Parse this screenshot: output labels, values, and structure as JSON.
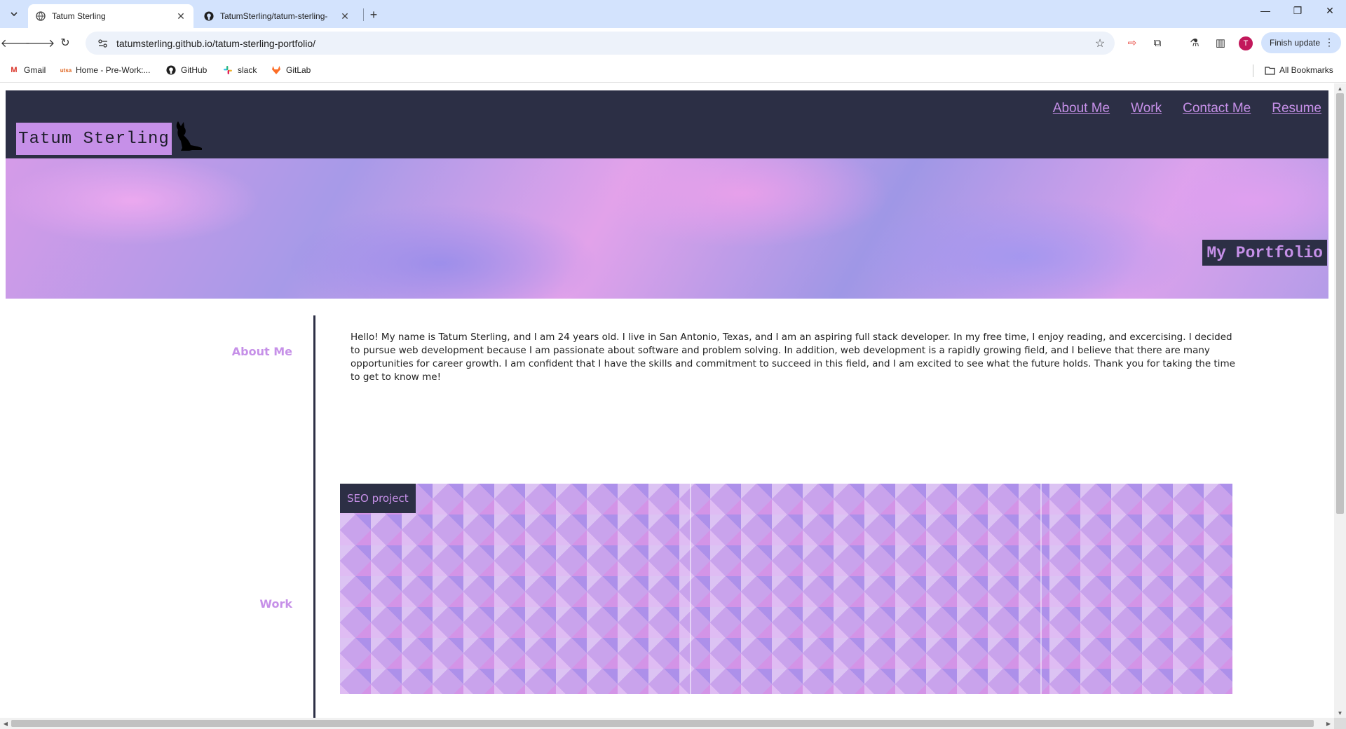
{
  "browser": {
    "tabs": [
      {
        "title": "Tatum Sterling",
        "active": true
      },
      {
        "title": "TatumSterling/tatum-sterling-",
        "active": false
      }
    ],
    "url": "tatumsterling.github.io/tatum-sterling-portfolio/",
    "finish_update_label": "Finish update",
    "avatar_letter": "T",
    "bookmarks": [
      {
        "label": "Gmail",
        "icon": "gmail-icon"
      },
      {
        "label": "Home - Pre-Work:...",
        "icon": "utsa-icon"
      },
      {
        "label": "GitHub",
        "icon": "github-icon"
      },
      {
        "label": "slack",
        "icon": "slack-icon"
      },
      {
        "label": "GitLab",
        "icon": "gitlab-icon"
      }
    ],
    "all_bookmarks_label": "All Bookmarks"
  },
  "site": {
    "logo_text": "Tatum Sterling",
    "nav": [
      "About Me",
      "Work",
      "Contact Me",
      "Resume"
    ],
    "hero_title": "My Portfolio",
    "sections": {
      "about_label": "About Me",
      "about_text": "Hello! My name is Tatum Sterling, and I am 24 years old. I live in San Antonio, Texas, and I am an aspiring full stack developer. In my free time, I enjoy reading, and excercising. I decided to pursue web development because I am passionate about software and problem solving. In addition, web development is a rapidly growing field, and I believe that there are many opportunities for career growth. I am confident that I have the skills and commitment to succeed in this field, and I am excited to see what the future holds. Thank you for taking the time to get to know me!",
      "work_label": "Work",
      "work_project_title": "SEO project"
    },
    "colors": {
      "header_bg": "#2c2f45",
      "accent_lavender": "#c690e8",
      "chrome_tabstrip": "#d3e3fd"
    }
  }
}
